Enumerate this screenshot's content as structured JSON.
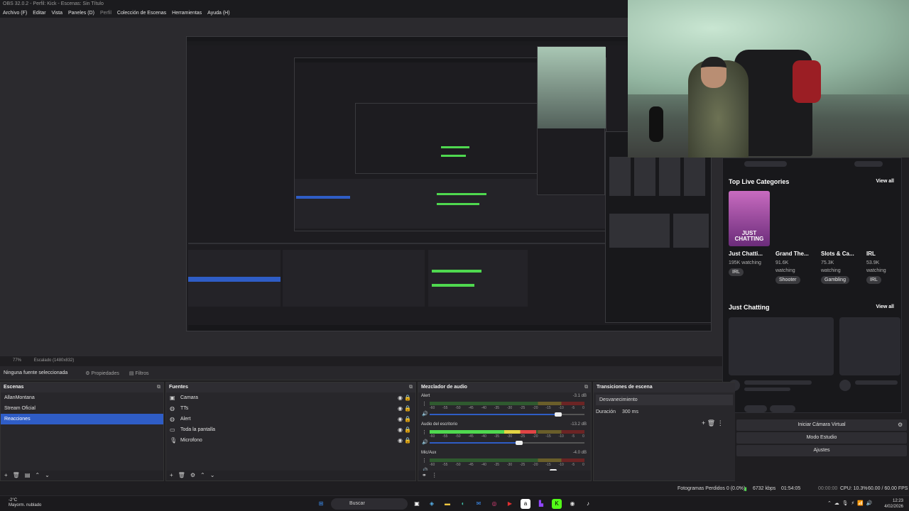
{
  "window": {
    "title": "OBS 32.0.2 - Perfil: Kick - Escenas: Sin Título"
  },
  "menu": [
    "Archivo (F)",
    "Editar",
    "Vista",
    "Paneles (D)",
    "Perfil",
    "Colección de Escenas",
    "Herramientas",
    "Ayuda (H)"
  ],
  "preview": {
    "zoom": "77%",
    "scaling": "Escalado (1480x832)"
  },
  "source_bar": {
    "selected": "Ninguna fuente seleccionada",
    "properties": "Propiedades",
    "filters": "Filtros"
  },
  "scenes": {
    "title": "Escenas",
    "items": [
      "AllanMontana",
      "Stream Oficial",
      "Reacciones"
    ],
    "selected_index": 2
  },
  "sources": {
    "title": "Fuentes",
    "items": [
      {
        "label": "Camara",
        "icon": "camera-icon"
      },
      {
        "label": "TTs",
        "icon": "globe-icon"
      },
      {
        "label": "Alert",
        "icon": "globe-icon"
      },
      {
        "label": "Toda la pantalla",
        "icon": "monitor-icon"
      },
      {
        "label": "Microfono",
        "icon": "microphone-icon"
      }
    ]
  },
  "mixer": {
    "title": "Mezclador de audio",
    "channels": [
      {
        "name": "Alert",
        "db": "-3.1 dB",
        "level": 0.0,
        "volume": 0.83
      },
      {
        "name": "Audio del escritorio",
        "db": "-13.2 dB",
        "level": 0.69,
        "volume": 0.58
      },
      {
        "name": "Mic/Aux",
        "db": "-4.0 dB",
        "level": 0.0,
        "volume": 0.8
      }
    ],
    "ticks": [
      "-60",
      "-55",
      "-50",
      "-45",
      "-40",
      "-35",
      "-30",
      "-25",
      "-20",
      "-15",
      "-10",
      "-5",
      "0"
    ]
  },
  "transitions": {
    "title": "Transiciones de escena",
    "selected": "Desvanecimiento",
    "duration_label": "Duración",
    "duration": "300 ms"
  },
  "controls": {
    "virtual_cam": "Iniciar Cámara Virtual",
    "studio_mode": "Modo Estudio",
    "settings": "Ajustes"
  },
  "kick_overlay": {
    "top_title": "Top Live Categories",
    "view_all": "View all",
    "categories": [
      {
        "name": "Just Chatti...",
        "viewers": "195K watching",
        "tag": "IRL",
        "thumb_text": "JUST CHATTING"
      },
      {
        "name": "Grand The...",
        "viewers": "91.6K watching",
        "tag": "Shooter"
      },
      {
        "name": "Slots & Ca...",
        "viewers": "75.3K watching",
        "tag": "Gambling"
      },
      {
        "name": "IRL",
        "viewers": "53.9K watching",
        "tag": "IRL"
      }
    ],
    "section_title": "Just Chatting"
  },
  "status": {
    "dropped": "Fotogramas Perdidos 0 (0.0%)",
    "bitrate": "6732 kbps",
    "stream_time": "01:54:05",
    "rec_time": "00:00:00",
    "cpu": "CPU: 10.3%",
    "fps": "60.00 / 60.00 FPS"
  },
  "taskbar": {
    "weather_temp": "-2°C",
    "weather_desc": "Mayorm. nublado",
    "search": "Buscar",
    "time": "12:23",
    "date": "4/02/2026"
  }
}
